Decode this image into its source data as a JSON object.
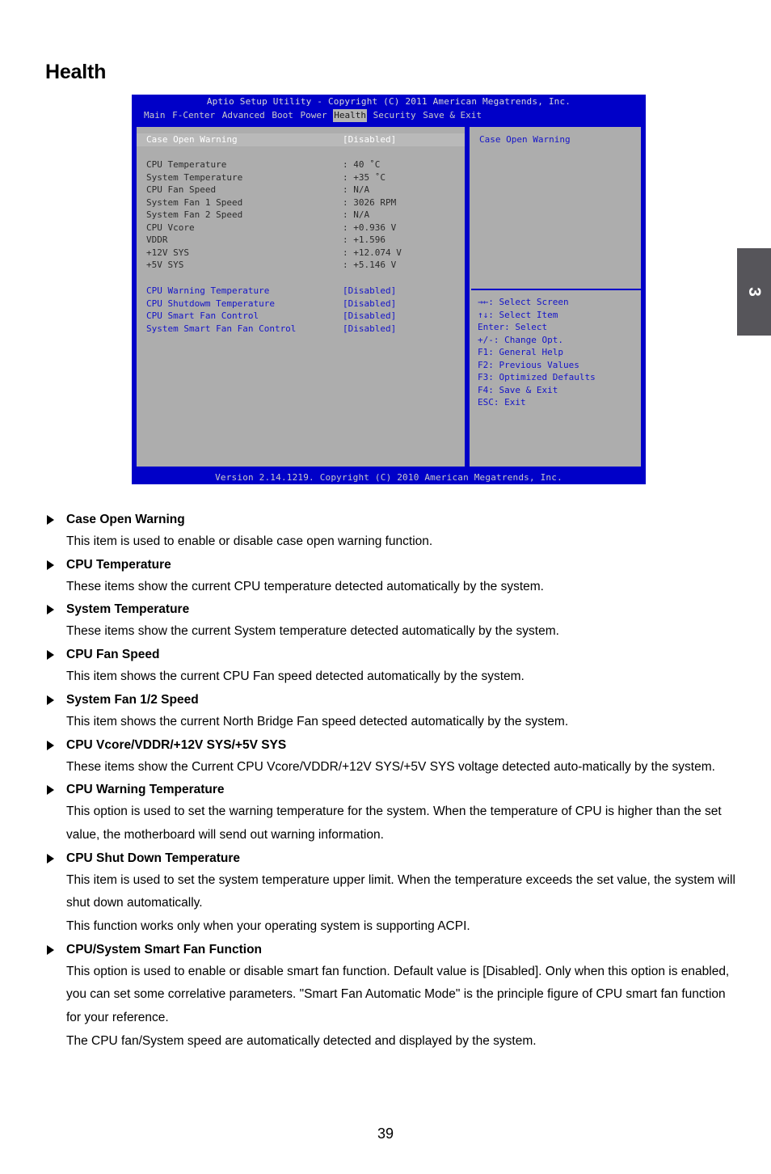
{
  "page": {
    "title": "Health",
    "number": "39",
    "chapter_tab": "3"
  },
  "bios": {
    "titlebar": "Aptio Setup Utility - Copyright (C) 2011 American Megatrends, Inc.",
    "menu": [
      {
        "label": "Main",
        "active": false
      },
      {
        "label": "F-Center",
        "active": false
      },
      {
        "label": "Advanced",
        "active": false
      },
      {
        "label": "Boot",
        "active": false
      },
      {
        "label": "Power",
        "active": false
      },
      {
        "label": "Health",
        "active": true
      },
      {
        "label": "Security",
        "active": false
      },
      {
        "label": "Save & Exit",
        "active": false
      }
    ],
    "selected_row": {
      "label": "Case Open Warning",
      "value": "[Disabled]"
    },
    "sensors": [
      {
        "label": "CPU Temperature",
        "value": ": 40 ˚C"
      },
      {
        "label": "System Temperature",
        "value": ": +35 ˚C"
      },
      {
        "label": "CPU Fan Speed",
        "value": ": N/A"
      },
      {
        "label": "System Fan 1 Speed",
        "value": ": 3026 RPM"
      },
      {
        "label": "System Fan 2 Speed",
        "value": ": N/A"
      },
      {
        "label": "CPU Vcore",
        "value": ": +0.936 V"
      },
      {
        "label": "VDDR",
        "value": ": +1.596"
      },
      {
        "label": "+12V SYS",
        "value": ": +12.074 V"
      },
      {
        "label": "+5V SYS",
        "value": ": +5.146 V"
      }
    ],
    "settings": [
      {
        "label": "CPU Warning Temperature",
        "value": "[Disabled]"
      },
      {
        "label": "CPU Shutdowm Temperature",
        "value": "[Disabled]"
      },
      {
        "label": "CPU Smart Fan Control",
        "value": "[Disabled]"
      },
      {
        "label": "System Smart Fan Fan Control",
        "value": "[Disabled]"
      }
    ],
    "help": {
      "title": "Case Open Warning",
      "keys": [
        "→←: Select Screen",
        "↑↓: Select Item",
        "Enter: Select",
        "+/-: Change Opt.",
        "F1: General Help",
        "F2: Previous Values",
        "F3: Optimized Defaults",
        "F4: Save & Exit",
        "ESC: Exit"
      ]
    },
    "footer": "Version 2.14.1219. Copyright (C) 2010 American Megatrends, Inc."
  },
  "doc": {
    "sections": [
      {
        "heading": "Case Open Warning",
        "paragraphs": [
          "This item is used to enable or disable case open warning function."
        ]
      },
      {
        "heading": "CPU Temperature",
        "paragraphs": [
          "These items show the current CPU temperature detected automatically by the system."
        ]
      },
      {
        "heading": "System Temperature",
        "paragraphs": [
          "These items show the current System temperature detected automatically by the system."
        ]
      },
      {
        "heading": "CPU Fan Speed",
        "paragraphs": [
          "This item shows the current CPU Fan speed detected automatically by the system."
        ]
      },
      {
        "heading": "System Fan 1/2 Speed",
        "paragraphs": [
          "This item shows the current North Bridge Fan speed detected automatically by the system."
        ]
      },
      {
        "heading": "CPU Vcore/VDDR/+12V SYS/+5V SYS",
        "paragraphs": [
          "These items show the Current CPU Vcore/VDDR/+12V SYS/+5V SYS voltage detected auto-matically by the system."
        ]
      },
      {
        "heading": "CPU Warning Temperature",
        "paragraphs": [
          "This option is used to set the warning temperature for the system. When the temperature of CPU is higher than the set value, the motherboard will send out warning information."
        ]
      },
      {
        "heading": "CPU Shut Down Temperature",
        "paragraphs": [
          "This item is used to set the system temperature upper limit. When the temperature exceeds the set value, the system will shut down automatically.",
          "This function works only when your operating system is supporting ACPI."
        ]
      },
      {
        "heading": "CPU/System Smart Fan Function",
        "paragraphs": [
          "This option is used to enable or disable smart fan function. Default value is [Disabled]. Only when this option is enabled, you can set some correlative parameters. \"Smart Fan Automatic Mode\" is the principle figure of CPU smart fan function for your reference.",
          "The CPU fan/System speed are automatically detected and displayed by the system."
        ]
      }
    ]
  }
}
